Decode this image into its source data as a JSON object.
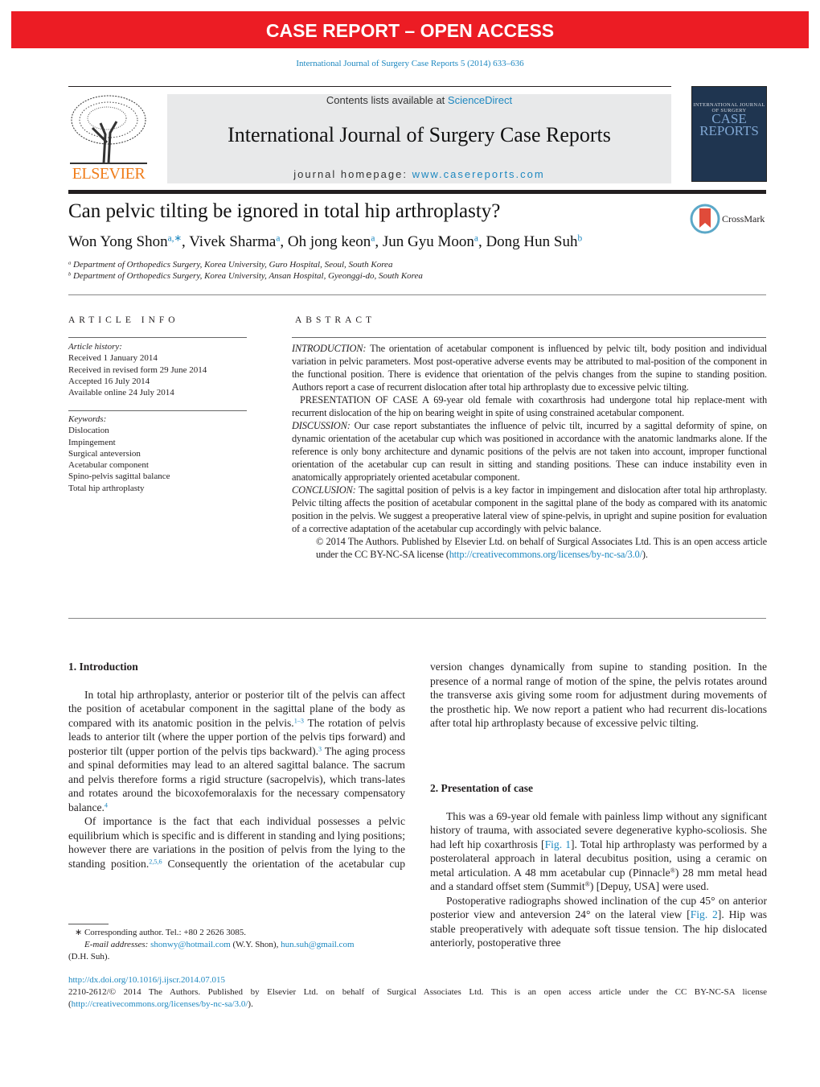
{
  "banner": "CASE REPORT – OPEN ACCESS",
  "citation": "International Journal of Surgery Case Reports 5 (2014) 633–636",
  "masthead": {
    "contents_prefix": "Contents lists available at ",
    "sciencedirect": "ScienceDirect",
    "journal_title": "International Journal of Surgery Case Reports",
    "homepage_prefix": "journal homepage: ",
    "homepage_url": "www.casereports.com",
    "publisher_logo": "ELSEVIER",
    "cover_line1": "INTERNATIONAL JOURNAL OF SURGERY",
    "cover_line2": "CASE REPORTS",
    "crossmark": "CrossMark"
  },
  "article": {
    "title": "Can pelvic tilting be ignored in total hip arthroplasty?",
    "authors": [
      {
        "name": "Won Yong Shon",
        "aff": "a,∗"
      },
      {
        "name": "Vivek Sharma",
        "aff": "a"
      },
      {
        "name": "Oh jong keon",
        "aff": "a"
      },
      {
        "name": "Jun Gyu Moon",
        "aff": "a"
      },
      {
        "name": "Dong Hun Suh",
        "aff": "b"
      }
    ],
    "affiliations": [
      {
        "mark": "a",
        "text": "Department of Orthopedics Surgery, Korea University, Guro Hospital, Seoul, South Korea"
      },
      {
        "mark": "b",
        "text": "Department of Orthopedics Surgery, Korea University, Ansan Hospital, Gyeonggi-do, South Korea"
      }
    ]
  },
  "article_info": {
    "heading": "ARTICLE INFO",
    "history_label": "Article history:",
    "history": [
      "Received 1 January 2014",
      "Received in revised form 29 June 2014",
      "Accepted 16 July 2014",
      "Available online 24 July 2014"
    ],
    "keywords_label": "Keywords:",
    "keywords": [
      "Dislocation",
      "Impingement",
      "Surgical anteversion",
      "Acetabular component",
      "Spino-pelvis sagittal balance",
      "Total hip arthroplasty"
    ]
  },
  "abstract": {
    "heading": "ABSTRACT",
    "intro_label": "INTRODUCTION:",
    "intro": " The orientation of acetabular component is influenced by pelvic tilt, body position and individual variation in pelvic parameters. Most post-operative adverse events may be attributed to mal-position of the component in the functional position. There is evidence that orientation of the pelvis changes from the supine to standing position. Authors report a case of recurrent dislocation after total hip arthroplasty due to excessive pelvic tilting.",
    "case": "PRESENTATION OF CASE A 69-year old female with coxarthrosis had undergone total hip replace-ment with recurrent dislocation of the hip on bearing weight in spite of using constrained acetabular component.",
    "discussion_label": "DISCUSSION:",
    "discussion": " Our case report substantiates the influence of pelvic tilt, incurred by a sagittal deformity of spine, on dynamic orientation of the acetabular cup which was positioned in accordance with the anatomic landmarks alone. If the reference is only bony architecture and dynamic positions of the pelvis are not taken into account, improper functional orientation of the acetabular cup can result in sitting and standing positions. These can induce instability even in anatomically appropriately oriented acetabular component.",
    "conclusion_label": "CONCLUSION:",
    "conclusion": " The sagittal position of pelvis is a key factor in impingement and dislocation after total hip arthroplasty. Pelvic tilting affects the position of acetabular component in the sagittal plane of the body as compared with its anatomic position in the pelvis. We suggest a preoperative lateral view of spine-pelvis, in upright and supine position for evaluation of a corrective adaptation of the acetabular cup accordingly with pelvic balance.",
    "copyright": "© 2014 The Authors. Published by Elsevier Ltd. on behalf of Surgical Associates Ltd. This is an open access article under the CC BY-NC-SA license (",
    "license_url": "http://creativecommons.org/licenses/by-nc-sa/3.0/",
    "copyright_end": ")."
  },
  "body": {
    "sections": [
      {
        "heading": "1.  Introduction",
        "paragraphs": [
          [
            {
              "t": "In total hip arthroplasty, anterior or posterior tilt of the pelvis can affect the position of acetabular component in the sagittal plane of the body as compared with its anatomic position in the pelvis."
            },
            {
              "ref": "1–3"
            },
            {
              "t": " The rotation of pelvis leads to anterior tilt (where the upper portion of the pelvis tips forward) and posterior tilt (upper portion of the pelvis tips backward)."
            },
            {
              "ref": "3"
            },
            {
              "t": " The aging process and spinal deformities may lead to an altered sagittal balance. The sacrum and pelvis therefore forms a rigid structure (sacropelvis), which trans-lates and rotates around the bicoxofemoralaxis for the necessary compensatory balance."
            },
            {
              "ref": "4"
            }
          ],
          [
            {
              "t": "Of importance is the fact that each individual possesses a pelvic equilibrium which is specific and is different in standing and lying positions; however there are variations in the position of pelvis from the lying to the standing position."
            },
            {
              "ref": "2,5,6"
            },
            {
              "t": " Consequently the orientation of the acetabular cup version changes dynamically from supine to standing position. In the presence of a normal range of motion of the spine, the pelvis rotates around the transverse axis giving some room for adjustment during movements of the prosthetic hip. We now report a patient who had recurrent dis-locations after total hip arthroplasty because of excessive pelvic tilting."
            }
          ]
        ]
      },
      {
        "heading": "2.  Presentation of case",
        "paragraphs": [
          [
            {
              "t": "This was a 69-year old female with painless limp without any significant history of trauma, with associated severe degenerative kypho-scoliosis. She had left hip coxarthrosis ["
            },
            {
              "link": "Fig. 1"
            },
            {
              "t": "]. Total hip arthroplasty was performed by a posterolateral approach in lateral decubitus position, using a ceramic on metal articulation. A 48 mm acetabular cup (Pinnacle"
            },
            {
              "sup": "®"
            },
            {
              "t": ") 28 mm metal head and a standard offset stem (Summit"
            },
            {
              "sup": "®"
            },
            {
              "t": ") [Depuy, USA] were used."
            }
          ],
          [
            {
              "t": "Postoperative radiographs showed inclination of the cup 45° on anterior posterior view and anteversion 24° on the lateral view ["
            },
            {
              "link": "Fig. 2"
            },
            {
              "t": "]. Hip was stable preoperatively with adequate soft tissue tension. The hip dislocated anteriorly, postoperative three"
            }
          ]
        ]
      }
    ]
  },
  "footnotes": {
    "corresponding": "∗  Corresponding author. Tel.: +80 2 2626 3085.",
    "email_label": "E-mail addresses: ",
    "email1": "shonwy@hotmail.com",
    "email1_owner": " (W.Y. Shon), ",
    "email2": "hun.suh@gmail.com",
    "email2_owner": "(D.H. Suh)."
  },
  "footer": {
    "doi": "http://dx.doi.org/10.1016/j.ijscr.2014.07.015",
    "copyright": "2210-2612/© 2014 The Authors. Published by Elsevier Ltd. on behalf of Surgical Associates Ltd. This is an open access article under the CC BY-NC-SA license",
    "license_open": "(",
    "license_url": "http://creativecommons.org/licenses/by-nc-sa/3.0/",
    "license_close": ")."
  },
  "colors": {
    "banner": "#ec1c24",
    "link": "#1e88c0",
    "elsevier": "#f07d1a"
  }
}
